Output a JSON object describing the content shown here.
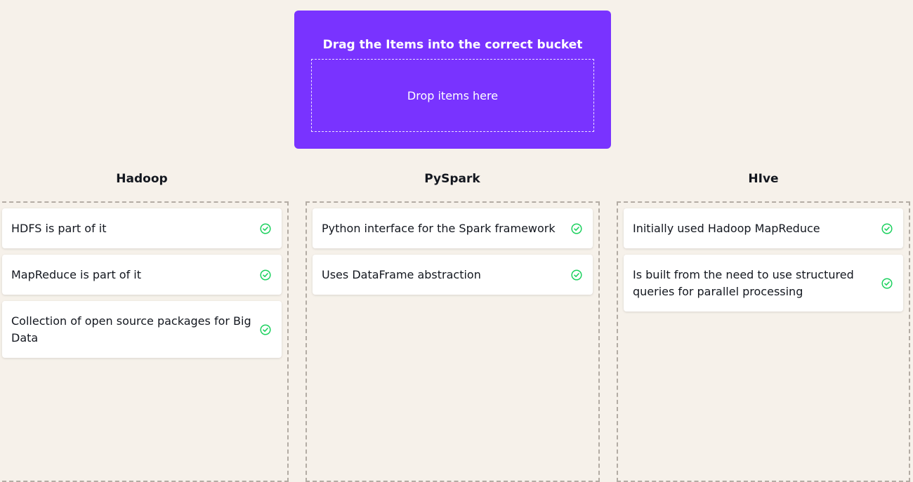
{
  "source": {
    "title": "Drag the Items into the correct bucket",
    "dropzone_text": "Drop items here"
  },
  "buckets": [
    {
      "title": "Hadoop",
      "items": [
        {
          "label": "HDFS is part of it",
          "status": "correct"
        },
        {
          "label": "MapReduce is part of it",
          "status": "correct"
        },
        {
          "label": "Collection of open source packages for Big Data",
          "status": "correct"
        }
      ]
    },
    {
      "title": "PySpark",
      "items": [
        {
          "label": "Python interface for the Spark framework",
          "status": "correct"
        },
        {
          "label": "Uses DataFrame abstraction",
          "status": "correct"
        }
      ]
    },
    {
      "title": "HIve",
      "items": [
        {
          "label": "Initially used Hadoop MapReduce",
          "status": "correct"
        },
        {
          "label": "Is built from the need to use structured queries for parallel processing",
          "status": "correct"
        }
      ]
    }
  ],
  "colors": {
    "accent": "#7933ff",
    "background": "#f6f1ea",
    "check": "#1dd15f"
  },
  "icons": {
    "correct": "check-circle-icon"
  }
}
